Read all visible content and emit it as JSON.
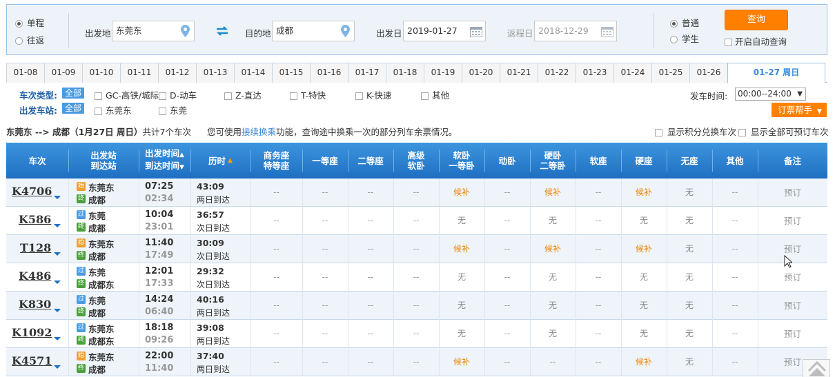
{
  "search": {
    "trip_type": [
      {
        "label": "单程",
        "selected": true
      },
      {
        "label": "往返",
        "selected": false
      }
    ],
    "from_label": "出发地",
    "from_value": "东莞东",
    "to_label": "目的地",
    "to_value": "成都",
    "depart_label": "出发日",
    "depart_value": "2019-01-27",
    "return_label": "返程日",
    "return_value": "2018-12-29",
    "passenger_type": [
      {
        "label": "普通",
        "selected": true
      },
      {
        "label": "学生",
        "selected": false
      }
    ],
    "query_label": "查询",
    "auto_query_label": "开启自动查询"
  },
  "date_tabs": [
    "01-08",
    "01-09",
    "01-10",
    "01-11",
    "01-12",
    "01-13",
    "01-14",
    "01-15",
    "01-16",
    "01-17",
    "01-18",
    "01-19",
    "01-20",
    "01-21",
    "01-22",
    "01-23",
    "01-24",
    "01-25",
    "01-26"
  ],
  "active_date_tab": "01-27 周日",
  "filters": {
    "train_type_label": "车次类型:",
    "station_label": "出发车站:",
    "all_label": "全部",
    "train_types": [
      "GC-高铁/城际",
      "D-动车",
      "Z-直达",
      "T-特快",
      "K-快速",
      "其他"
    ],
    "stations": [
      "东莞东",
      "东莞"
    ],
    "depart_time_label": "发车时间:",
    "depart_time_value": "00:00--24:00",
    "helper_label": "订票帮手"
  },
  "summary": {
    "route": "东莞东 --> 成都",
    "date": "（1月27日  周日）",
    "count": "共计7个车次",
    "notice_prefix": "您可使用",
    "notice_link": "接续换乘",
    "notice_suffix": "功能，查询途中换乘一次的部分列车余票情况。",
    "opt_points": "显示积分兑换车次",
    "opt_all": "显示全部可预订车次"
  },
  "table": {
    "headers": {
      "train": "车次",
      "station_1": "出发站",
      "station_2": "到达站",
      "time_1": "出发时间",
      "time_2": "到达时间",
      "duration": "历时",
      "business_1": "商务座",
      "business_2": "特等座",
      "first": "一等座",
      "second": "二等座",
      "premium_1": "高级",
      "premium_2": "软卧",
      "soft_sleeper_1": "软卧",
      "soft_sleeper_2": "一等卧",
      "motor_sleeper": "动卧",
      "hard_sleeper_1": "硬卧",
      "hard_sleeper_2": "二等卧",
      "soft_seat": "软座",
      "hard_seat": "硬座",
      "no_seat": "无座",
      "other": "其他",
      "remark": "备注"
    },
    "rows": [
      {
        "train": "K4706",
        "from_badge": "始",
        "from": "东莞东",
        "to_badge": "终",
        "to": "成都",
        "dep": "07:25",
        "arr": "02:34",
        "dur": "43:09",
        "arrive_day": "两日到达",
        "seats": [
          "--",
          "--",
          "--",
          "--",
          "候补",
          "--",
          "候补",
          "--",
          "候补",
          "无",
          "--"
        ],
        "book": "预订"
      },
      {
        "train": "K586",
        "from_badge": "过",
        "from": "东莞",
        "to_badge": "终",
        "to": "成都",
        "dep": "10:04",
        "arr": "23:01",
        "dur": "36:57",
        "arrive_day": "次日到达",
        "seats": [
          "--",
          "--",
          "--",
          "--",
          "无",
          "--",
          "无",
          "--",
          "无",
          "无",
          "--"
        ],
        "book": "预订"
      },
      {
        "train": "T128",
        "from_badge": "始",
        "from": "东莞东",
        "to_badge": "终",
        "to": "成都",
        "dep": "11:40",
        "arr": "17:49",
        "dur": "30:09",
        "arrive_day": "次日到达",
        "seats": [
          "--",
          "--",
          "--",
          "--",
          "候补",
          "--",
          "候补",
          "--",
          "候补",
          "无",
          "--"
        ],
        "book": "预订"
      },
      {
        "train": "K486",
        "from_badge": "过",
        "from": "东莞",
        "to_badge": "终",
        "to": "成都东",
        "dep": "12:01",
        "arr": "17:33",
        "dur": "29:32",
        "arrive_day": "次日到达",
        "seats": [
          "--",
          "--",
          "--",
          "--",
          "无",
          "--",
          "无",
          "--",
          "无",
          "无",
          "--"
        ],
        "book": "预订"
      },
      {
        "train": "K830",
        "from_badge": "过",
        "from": "东莞",
        "to_badge": "终",
        "to": "成都",
        "dep": "14:24",
        "arr": "06:40",
        "dur": "40:16",
        "arrive_day": "两日到达",
        "seats": [
          "--",
          "--",
          "--",
          "--",
          "无",
          "--",
          "无",
          "--",
          "无",
          "无",
          "--"
        ],
        "book": "预订"
      },
      {
        "train": "K1092",
        "from_badge": "过",
        "from": "东莞东",
        "to_badge": "终",
        "to": "成都东",
        "dep": "18:18",
        "arr": "09:26",
        "dur": "39:08",
        "arrive_day": "两日到达",
        "seats": [
          "--",
          "--",
          "--",
          "--",
          "无",
          "--",
          "无",
          "--",
          "无",
          "无",
          "--"
        ],
        "book": "预订"
      },
      {
        "train": "K4571",
        "from_badge": "始",
        "from": "东莞东",
        "to_badge": "终",
        "to": "成都",
        "dep": "22:00",
        "arr": "11:40",
        "dur": "37:40",
        "arrive_day": "两日到达",
        "seats": [
          "--",
          "--",
          "--",
          "--",
          "候补",
          "--",
          "--",
          "--",
          "候补",
          "无",
          "--"
        ],
        "book": "预订"
      }
    ]
  },
  "colors": {
    "accent_orange": "#ff8000",
    "header_blue": "#1e6fc2",
    "link_blue": "#3a8ad8",
    "wait_orange": "#f08300"
  }
}
